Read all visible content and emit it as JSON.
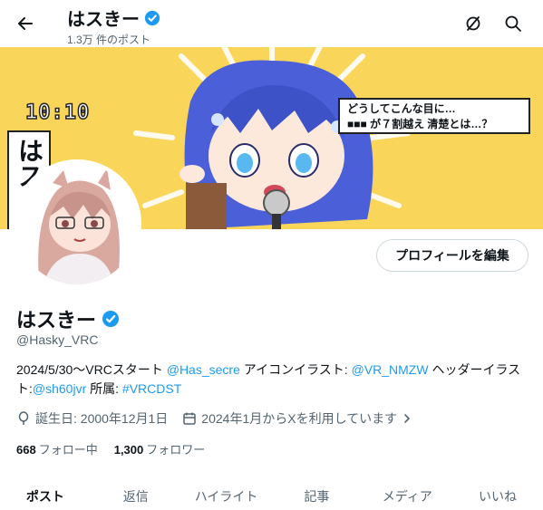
{
  "header": {
    "display_name": "はスきー",
    "post_count": "1.3万 件のポスト"
  },
  "banner": {
    "clock": "10:10",
    "vertical_text": "はスきー",
    "caption_line1": "どうしてこんな目に…",
    "caption_line2": "■■■ が７割越え 清楚とは…？"
  },
  "profile": {
    "edit_button": "プロフィールを編集",
    "display_name": "はスきー",
    "handle": "@Hasky_VRC",
    "bio": {
      "t1": "2024/5/30～VRCスタート ",
      "l1": "@Has_secre",
      "t2": " アイコンイラスト: ",
      "l2": "@VR_NMZW",
      "t3": " ヘッダーイラスト:",
      "l3": "@sh60jvr",
      "t4": " 所属: ",
      "l4": "#VRCDST"
    },
    "birthday": "誕生日: 2000年12月1日",
    "joined": "2024年1月からXを利用しています",
    "following_count": "668",
    "following_label": "フォロー中",
    "followers_count": "1,300",
    "followers_label": "フォロワー"
  },
  "tabs": [
    "ポスト",
    "返信",
    "ハイライト",
    "記事",
    "メディア",
    "いいね"
  ],
  "colors": {
    "accent": "#1d9bf0",
    "banner_bg": "#f9d65a",
    "verified": "#1d9bf0"
  }
}
